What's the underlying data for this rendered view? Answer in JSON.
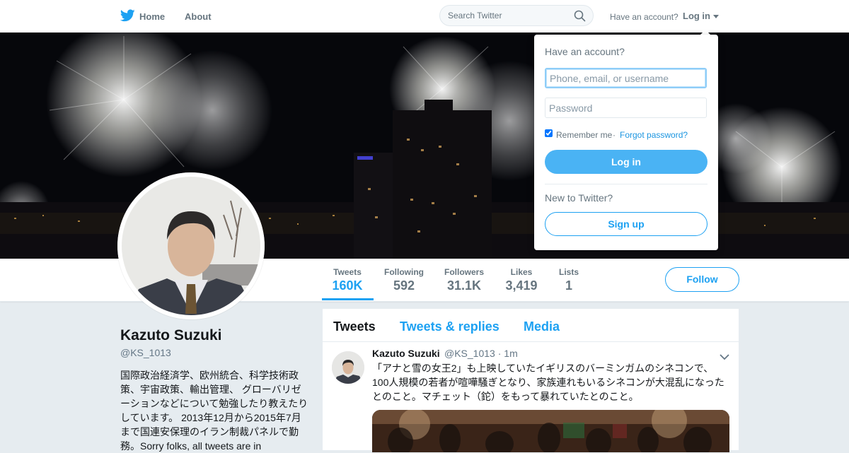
{
  "nav": {
    "home_label": "Home",
    "about_label": "About",
    "search_placeholder": "Search Twitter",
    "have_account": "Have an account?",
    "login_label": "Log in",
    "icons": {
      "logo": "twitter-bird-icon",
      "search": "search-icon",
      "caret": "caret-down-icon"
    },
    "brand_color": "#1da1f2"
  },
  "profile": {
    "name": "Kazuto Suzuki",
    "handle": "@KS_1013",
    "bio": "国際政治経済学、欧州統合、科学技術政策、宇宙政策、輸出管理、 グローバリゼーションなどについて勉強したり教えたりしています。 2013年12月から2015年7月まで国連安保理のイラン制裁パネルで勤務。Sorry folks, all tweets are in"
  },
  "stats": [
    {
      "label": "Tweets",
      "value": "160K",
      "active": true
    },
    {
      "label": "Following",
      "value": "592"
    },
    {
      "label": "Followers",
      "value": "31.1K"
    },
    {
      "label": "Likes",
      "value": "3,419"
    },
    {
      "label": "Lists",
      "value": "1"
    }
  ],
  "follow_label": "Follow",
  "timeline": {
    "tabs": [
      "Tweets",
      "Tweets & replies",
      "Media"
    ],
    "tweet": {
      "name": "Kazuto Suzuki",
      "handle": "@KS_1013",
      "sep": "·",
      "time": "1m",
      "text": "「アナと雪の女王2」も上映していたイギリスのバーミンガムのシネコンで、100人規模の若者が喧嘩騒ぎとなり、家族連れもいるシネコンが大混乱になったとのこと。マチェット（鉈）をもって暴れていたとのこと。"
    }
  },
  "login_dropdown": {
    "title": "Have an account?",
    "username_placeholder": "Phone, email, or username",
    "password_placeholder": "Password",
    "remember_label": "Remember me",
    "separator": "·",
    "forgot_label": "Forgot password?",
    "login_button": "Log in",
    "new_label": "New to Twitter?",
    "signup_button": "Sign up",
    "remember_checked": true
  }
}
